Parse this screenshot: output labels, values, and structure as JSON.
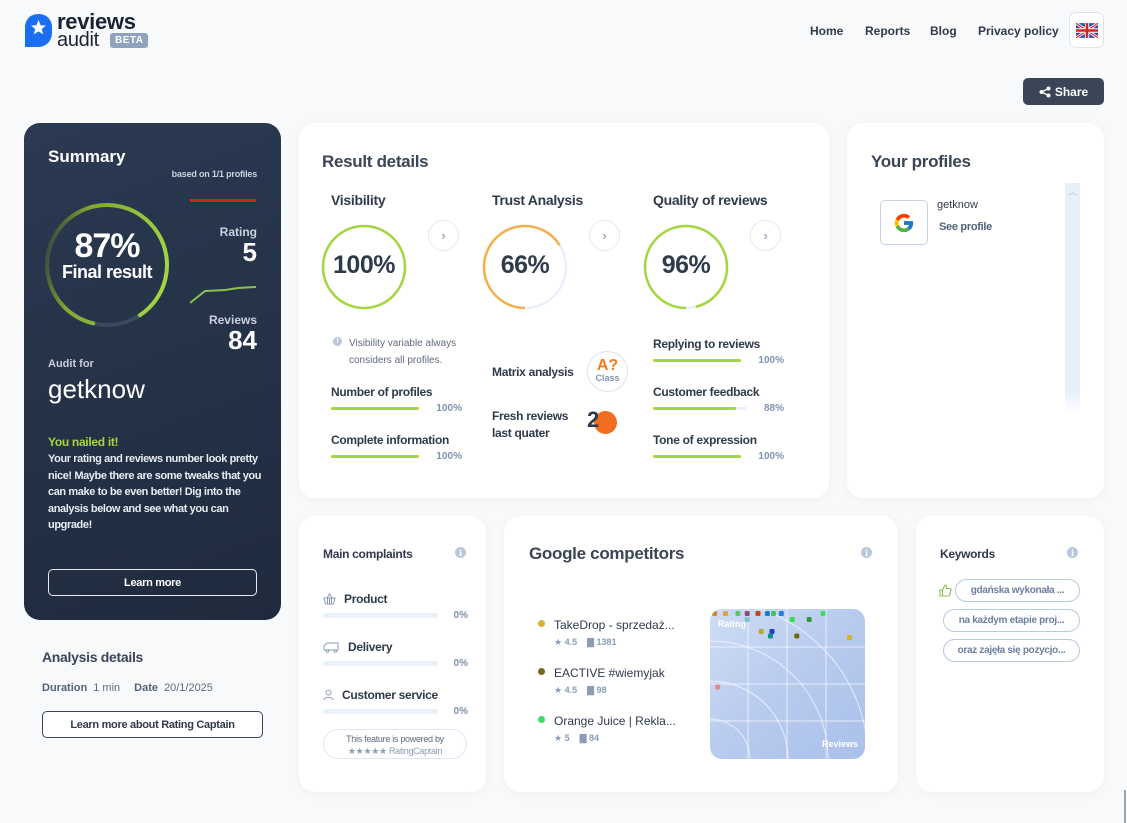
{
  "header": {
    "logo": {
      "line1": "reviews",
      "line2": "audit",
      "badge": "BETA"
    },
    "nav": [
      "Home",
      "Reports",
      "Blog",
      "Privacy policy"
    ],
    "language_icon": "uk-flag-icon",
    "share_label": "Share"
  },
  "summary": {
    "title": "Summary",
    "based_on": "based on 1/1 profiles",
    "final_percent": "87%",
    "final_value": 0.87,
    "final_label": "Final result",
    "rating_label": "Rating",
    "rating_value": "5",
    "reviews_label": "Reviews",
    "reviews_value": "84",
    "audit_for_label": "Audit for",
    "audit_name": "getknow",
    "headline": "You nailed it!",
    "message": "Your rating and reviews number look pretty nice! Maybe there are some tweaks that you can make to be even better! Dig into the analysis below and see what you can upgrade!",
    "learn_more": "Learn more"
  },
  "analysis": {
    "title": "Analysis details",
    "duration_label": "Duration",
    "duration_value": "1 min",
    "date_label": "Date",
    "date_value": "20/1/2025",
    "button": "Learn more about Rating Captain"
  },
  "result": {
    "title": "Result details",
    "visibility": {
      "title": "Visibility",
      "value": "100%",
      "fraction": 1.0,
      "color": "#a4d63d",
      "note": "Visibility variable always considers all profiles.",
      "metrics": [
        {
          "label": "Number of profiles",
          "value": "100%",
          "fraction": 1.0
        },
        {
          "label": "Complete information",
          "value": "100%",
          "fraction": 1.0
        }
      ]
    },
    "trust": {
      "title": "Trust Analysis",
      "value": "66%",
      "fraction": 0.66,
      "color": "#f6b04a",
      "matrix_label": "Matrix analysis",
      "matrix_class": "A?",
      "matrix_class_sub": "Class",
      "fresh_label_1": "Fresh reviews",
      "fresh_label_2": "last quater",
      "fresh_value": "2"
    },
    "quality": {
      "title": "Quality of reviews",
      "value": "96%",
      "fraction": 0.96,
      "color": "#a4d63d",
      "metrics": [
        {
          "label": "Replying to reviews",
          "value": "100%",
          "fraction": 1.0
        },
        {
          "label": "Customer feedback",
          "value": "88%",
          "fraction": 0.88
        },
        {
          "label": "Tone of expression",
          "value": "100%",
          "fraction": 1.0
        }
      ]
    }
  },
  "profiles": {
    "title": "Your profiles",
    "items": [
      {
        "name": "getknow",
        "link": "See profile",
        "icon": "google-icon"
      }
    ]
  },
  "complaints": {
    "title": "Main complaints",
    "items": [
      {
        "label": "Product",
        "value": "0%",
        "icon": "basket-icon"
      },
      {
        "label": "Delivery",
        "value": "0%",
        "icon": "truck-icon"
      },
      {
        "label": "Customer service",
        "value": "0%",
        "icon": "person-icon"
      }
    ],
    "powered_line1": "This feature is powered by",
    "powered_line2": "★★★★★ RatingCaptain"
  },
  "competitors": {
    "title": "Google competitors",
    "items": [
      {
        "name": "TakeDrop - sprzedaż...",
        "rating": "4.5",
        "reviews": "1381",
        "color": "#d4b22c"
      },
      {
        "name": "EACTIVE #wiemyjak",
        "rating": "4.5",
        "reviews": "98",
        "color": "#7a6415"
      },
      {
        "name": "Orange Juice | Rekla...",
        "rating": "5",
        "reviews": "84",
        "color": "#3ddc6a"
      }
    ],
    "chart": {
      "y_label": "Rating",
      "x_label": "Reviews",
      "points": [
        {
          "x": 0.03,
          "y": 0.97,
          "color": "#c88a2a"
        },
        {
          "x": 0.1,
          "y": 0.97,
          "color": "#e0a040"
        },
        {
          "x": 0.18,
          "y": 0.97,
          "color": "#5cc46a"
        },
        {
          "x": 0.24,
          "y": 0.97,
          "color": "#8e4a7a"
        },
        {
          "x": 0.24,
          "y": 0.93,
          "color": "#7fc4c4"
        },
        {
          "x": 0.31,
          "y": 0.97,
          "color": "#c0441c"
        },
        {
          "x": 0.37,
          "y": 0.97,
          "color": "#1d78d8"
        },
        {
          "x": 0.41,
          "y": 0.97,
          "color": "#44c454"
        },
        {
          "x": 0.46,
          "y": 0.97,
          "color": "#2a7ad8"
        },
        {
          "x": 0.53,
          "y": 0.93,
          "color": "#2ee04a"
        },
        {
          "x": 0.64,
          "y": 0.93,
          "color": "#2a9a3a"
        },
        {
          "x": 0.73,
          "y": 0.97,
          "color": "#3ddc6a"
        },
        {
          "x": 0.33,
          "y": 0.85,
          "color": "#b8a830"
        },
        {
          "x": 0.4,
          "y": 0.85,
          "color": "#1d3ad8"
        },
        {
          "x": 0.39,
          "y": 0.82,
          "color": "#138a8a"
        },
        {
          "x": 0.56,
          "y": 0.82,
          "color": "#7a6415"
        },
        {
          "x": 0.9,
          "y": 0.81,
          "color": "#d4b22c"
        },
        {
          "x": 0.05,
          "y": 0.48,
          "color": "#e08a8a"
        }
      ]
    }
  },
  "keywords": {
    "title": "Keywords",
    "items": [
      "gdańska wykonała ...",
      "na każdym etapie proj...",
      "oraz zajęła się pozycjo..."
    ]
  }
}
